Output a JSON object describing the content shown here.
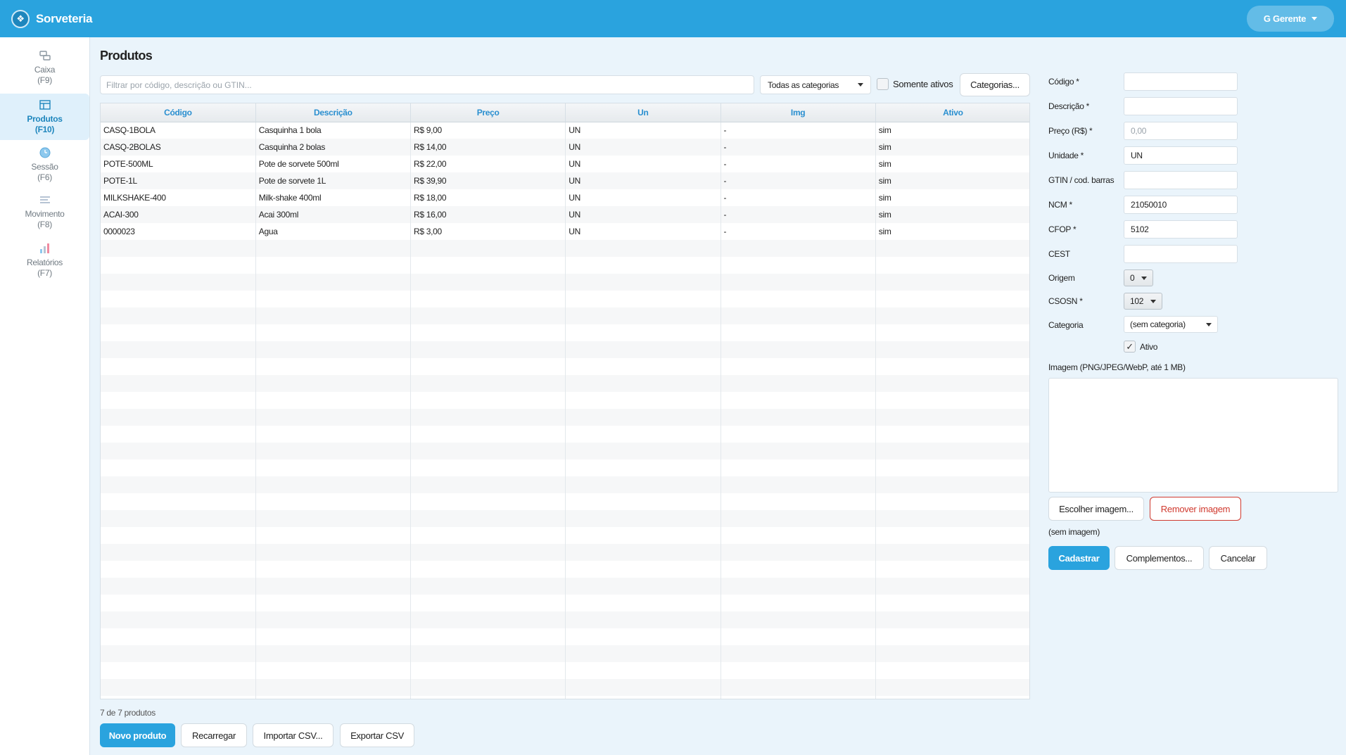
{
  "app": {
    "title": "Sorveteria",
    "user_label": "G Gerente"
  },
  "nav": [
    {
      "label": "Caixa",
      "key": "(F9)",
      "icon": "cash-register-icon",
      "active": false
    },
    {
      "label": "Produtos",
      "key": "(F10)",
      "icon": "store-icon",
      "active": true
    },
    {
      "label": "Sessão",
      "key": "(F6)",
      "icon": "clock-icon",
      "active": false
    },
    {
      "label": "Movimento",
      "key": "(F8)",
      "icon": "list-lines-icon",
      "active": false
    },
    {
      "label": "Relatórios",
      "key": "(F7)",
      "icon": "bar-chart-icon",
      "active": false
    }
  ],
  "page": {
    "title": "Produtos"
  },
  "filter": {
    "placeholder": "Filtrar por código, descrição ou GTIN...",
    "category_select": "Todas as categorias",
    "only_active_label": "Somente ativos",
    "categories_button": "Categorias..."
  },
  "table": {
    "columns": [
      "Código",
      "Descrição",
      "Preço",
      "Un",
      "Img",
      "Ativo"
    ],
    "rows": [
      [
        "CASQ-1BOLA",
        "Casquinha 1 bola",
        "R$ 9,00",
        "UN",
        "-",
        "sim"
      ],
      [
        "CASQ-2BOLAS",
        "Casquinha 2 bolas",
        "R$ 14,00",
        "UN",
        "-",
        "sim"
      ],
      [
        "POTE-500ML",
        "Pote de sorvete 500ml",
        "R$ 22,00",
        "UN",
        "-",
        "sim"
      ],
      [
        "POTE-1L",
        "Pote de sorvete 1L",
        "R$ 39,90",
        "UN",
        "-",
        "sim"
      ],
      [
        "MILKSHAKE-400",
        "Milk-shake 400ml",
        "R$ 18,00",
        "UN",
        "-",
        "sim"
      ],
      [
        "ACAI-300",
        "Acai 300ml",
        "R$ 16,00",
        "UN",
        "-",
        "sim"
      ],
      [
        "0000023",
        "Agua",
        "R$ 3,00",
        "UN",
        "-",
        "sim"
      ]
    ]
  },
  "footer": {
    "count": "7 de 7 produtos",
    "new_button": "Novo produto",
    "reload_button": "Recarregar",
    "import_button": "Importar CSV...",
    "export_button": "Exportar CSV"
  },
  "form": {
    "codigo_label": "Código *",
    "codigo_value": "",
    "descricao_label": "Descrição *",
    "descricao_value": "",
    "preco_label": "Preço (R$) *",
    "preco_placeholder": "0,00",
    "unidade_label": "Unidade *",
    "unidade_value": "UN",
    "gtin_label": "GTIN / cod. barras",
    "gtin_value": "",
    "ncm_label": "NCM *",
    "ncm_value": "21050010",
    "cfop_label": "CFOP *",
    "cfop_value": "5102",
    "cest_label": "CEST",
    "cest_value": "",
    "origem_label": "Origem",
    "origem_value": "0",
    "csosn_label": "CSOSN *",
    "csosn_value": "102",
    "categoria_label": "Categoria",
    "categoria_value": "(sem categoria)",
    "ativo_label": "Ativo",
    "ativo_checked": "✓",
    "imagem_label": "Imagem (PNG/JPEG/WebP, até 1 MB)",
    "choose_image_button": "Escolher imagem...",
    "remove_image_button": "Remover imagem",
    "image_status": "(sem imagem)",
    "submit_button": "Cadastrar",
    "complements_button": "Complementos...",
    "cancel_button": "Cancelar"
  },
  "colors": {
    "primary": "#2aa3de",
    "danger": "#d03a2f",
    "background": "#eaf4fb"
  }
}
